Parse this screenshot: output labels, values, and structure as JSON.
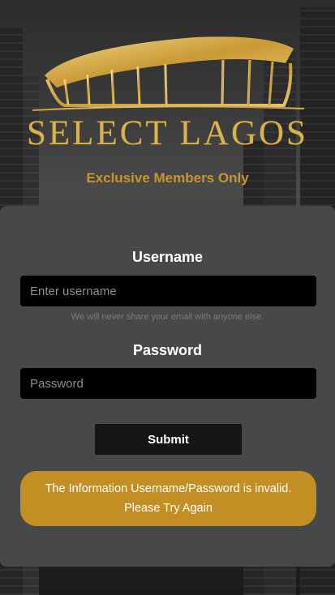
{
  "brand": {
    "name": "SELECT LAGOS",
    "tagline": "Exclusive Members Only",
    "color": "#d9b24f"
  },
  "form": {
    "username_label": "Username",
    "username_placeholder": "Enter username",
    "username_help": "We will never share your email with anyone else.",
    "password_label": "Password",
    "password_placeholder": "Password",
    "submit_label": "Submit"
  },
  "alert": {
    "line1": "The Information Username/Password is invalid.",
    "line2": "Please Try Again",
    "color": "#c38f25"
  }
}
